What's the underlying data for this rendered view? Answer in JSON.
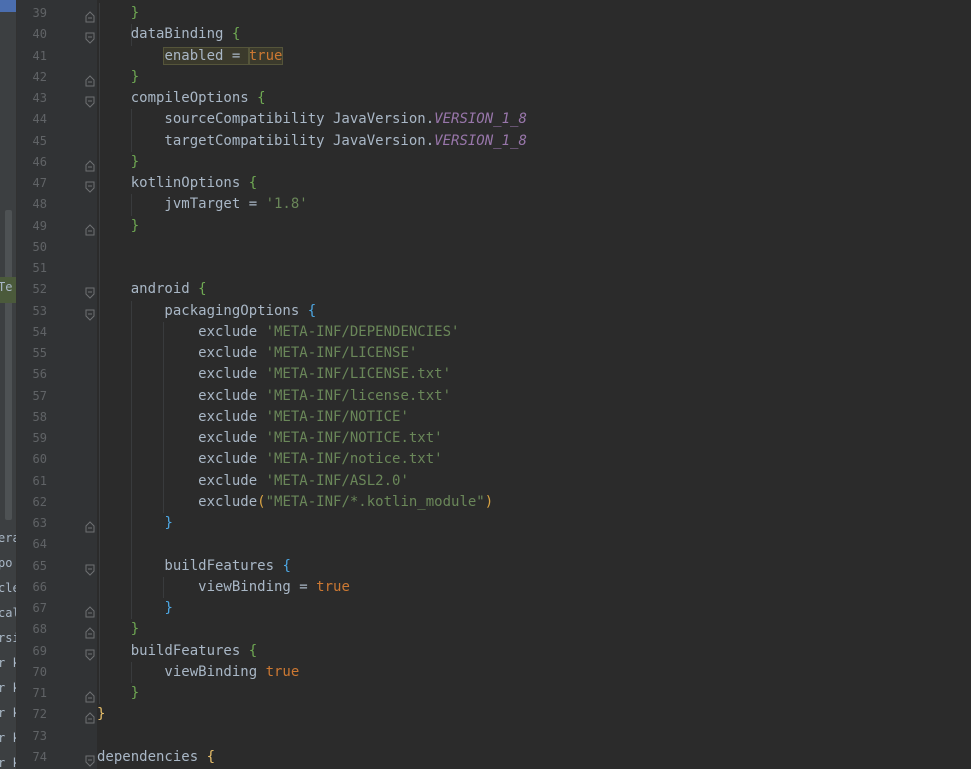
{
  "side_panel": {
    "fragments": [
      "Te",
      "era",
      "po",
      "cle",
      "cal",
      "rsi",
      "r k",
      "r k",
      "r k",
      "r k",
      "r k"
    ]
  },
  "colors": {
    "background": "#2b2b2b",
    "keyword": "#cc7832",
    "string": "#6a8759",
    "constant": "#9876aa",
    "text": "#a9b7c6",
    "line_number": "#606366"
  },
  "lines": [
    {
      "n": "39",
      "fold": "end",
      "tokens": [
        {
          "t": "    "
        },
        {
          "t": "}",
          "c": "b-green"
        }
      ]
    },
    {
      "n": "40",
      "fold": "start",
      "tokens": [
        {
          "t": "    dataBinding "
        },
        {
          "t": "{",
          "c": "b-green"
        }
      ]
    },
    {
      "n": "41",
      "fold": "",
      "tokens": [
        {
          "t": "        "
        },
        {
          "t": "enabled = ",
          "hl": true
        },
        {
          "t": "true",
          "c": "t-true",
          "hl": true
        }
      ]
    },
    {
      "n": "42",
      "fold": "end",
      "tokens": [
        {
          "t": "    "
        },
        {
          "t": "}",
          "c": "b-green"
        }
      ]
    },
    {
      "n": "43",
      "fold": "start",
      "tokens": [
        {
          "t": "    compileOptions "
        },
        {
          "t": "{",
          "c": "b-green"
        }
      ]
    },
    {
      "n": "44",
      "fold": "",
      "tokens": [
        {
          "t": "        sourceCompatibility JavaVersion."
        },
        {
          "t": "VERSION_1_8",
          "c": "t-const"
        }
      ]
    },
    {
      "n": "45",
      "fold": "",
      "tokens": [
        {
          "t": "        targetCompatibility JavaVersion."
        },
        {
          "t": "VERSION_1_8",
          "c": "t-const"
        }
      ]
    },
    {
      "n": "46",
      "fold": "end",
      "tokens": [
        {
          "t": "    "
        },
        {
          "t": "}",
          "c": "b-green"
        }
      ]
    },
    {
      "n": "47",
      "fold": "start",
      "tokens": [
        {
          "t": "    kotlinOptions "
        },
        {
          "t": "{",
          "c": "b-green"
        }
      ]
    },
    {
      "n": "48",
      "fold": "",
      "tokens": [
        {
          "t": "        jvmTarget = "
        },
        {
          "t": "'1.8'",
          "c": "t-str"
        }
      ]
    },
    {
      "n": "49",
      "fold": "end",
      "tokens": [
        {
          "t": "    "
        },
        {
          "t": "}",
          "c": "b-green"
        }
      ]
    },
    {
      "n": "50",
      "fold": "",
      "tokens": []
    },
    {
      "n": "51",
      "fold": "",
      "tokens": []
    },
    {
      "n": "52",
      "fold": "start",
      "tokens": [
        {
          "t": "    android "
        },
        {
          "t": "{",
          "c": "b-green"
        }
      ]
    },
    {
      "n": "53",
      "fold": "start",
      "tokens": [
        {
          "t": "        packagingOptions "
        },
        {
          "t": "{",
          "c": "b-blue"
        }
      ]
    },
    {
      "n": "54",
      "fold": "",
      "tokens": [
        {
          "t": "            exclude "
        },
        {
          "t": "'META-INF/DEPENDENCIES'",
          "c": "t-str"
        }
      ]
    },
    {
      "n": "55",
      "fold": "",
      "tokens": [
        {
          "t": "            exclude "
        },
        {
          "t": "'META-INF/LICENSE'",
          "c": "t-str"
        }
      ]
    },
    {
      "n": "56",
      "fold": "",
      "tokens": [
        {
          "t": "            exclude "
        },
        {
          "t": "'META-INF/LICENSE.txt'",
          "c": "t-str"
        }
      ]
    },
    {
      "n": "57",
      "fold": "",
      "tokens": [
        {
          "t": "            exclude "
        },
        {
          "t": "'META-INF/license.txt'",
          "c": "t-str"
        }
      ]
    },
    {
      "n": "58",
      "fold": "",
      "tokens": [
        {
          "t": "            exclude "
        },
        {
          "t": "'META-INF/NOTICE'",
          "c": "t-str"
        }
      ]
    },
    {
      "n": "59",
      "fold": "",
      "tokens": [
        {
          "t": "            exclude "
        },
        {
          "t": "'META-INF/NOTICE.txt'",
          "c": "t-str"
        }
      ]
    },
    {
      "n": "60",
      "fold": "",
      "tokens": [
        {
          "t": "            exclude "
        },
        {
          "t": "'META-INF/notice.txt'",
          "c": "t-str"
        }
      ]
    },
    {
      "n": "61",
      "fold": "",
      "tokens": [
        {
          "t": "            exclude "
        },
        {
          "t": "'META-INF/ASL2.0'",
          "c": "t-str"
        }
      ]
    },
    {
      "n": "62",
      "fold": "",
      "tokens": [
        {
          "t": "            exclude"
        },
        {
          "t": "(",
          "c": "b-orange"
        },
        {
          "t": "\"META-INF/*.kotlin_module\"",
          "c": "t-str"
        },
        {
          "t": ")",
          "c": "b-orange"
        }
      ]
    },
    {
      "n": "63",
      "fold": "end",
      "tokens": [
        {
          "t": "        "
        },
        {
          "t": "}",
          "c": "b-blue"
        }
      ]
    },
    {
      "n": "64",
      "fold": "",
      "tokens": []
    },
    {
      "n": "65",
      "fold": "start",
      "tokens": [
        {
          "t": "        buildFeatures "
        },
        {
          "t": "{",
          "c": "b-blue"
        }
      ]
    },
    {
      "n": "66",
      "fold": "",
      "tokens": [
        {
          "t": "            viewBinding = "
        },
        {
          "t": "true",
          "c": "t-true"
        }
      ]
    },
    {
      "n": "67",
      "fold": "end",
      "tokens": [
        {
          "t": "        "
        },
        {
          "t": "}",
          "c": "b-blue"
        }
      ]
    },
    {
      "n": "68",
      "fold": "end",
      "tokens": [
        {
          "t": "    "
        },
        {
          "t": "}",
          "c": "b-green"
        }
      ]
    },
    {
      "n": "69",
      "fold": "start",
      "tokens": [
        {
          "t": "    buildFeatures "
        },
        {
          "t": "{",
          "c": "b-green"
        }
      ]
    },
    {
      "n": "70",
      "fold": "",
      "tokens": [
        {
          "t": "        viewBinding "
        },
        {
          "t": "true",
          "c": "t-true"
        }
      ]
    },
    {
      "n": "71",
      "fold": "end",
      "tokens": [
        {
          "t": "    "
        },
        {
          "t": "}",
          "c": "b-green"
        }
      ]
    },
    {
      "n": "72",
      "fold": "end",
      "tokens": [
        {
          "t": "}",
          "c": "b-yellow"
        }
      ]
    },
    {
      "n": "73",
      "fold": "",
      "tokens": []
    },
    {
      "n": "74",
      "fold": "start",
      "tokens": [
        {
          "t": "dependencies "
        },
        {
          "t": "{",
          "c": "b-yellow"
        }
      ]
    }
  ]
}
